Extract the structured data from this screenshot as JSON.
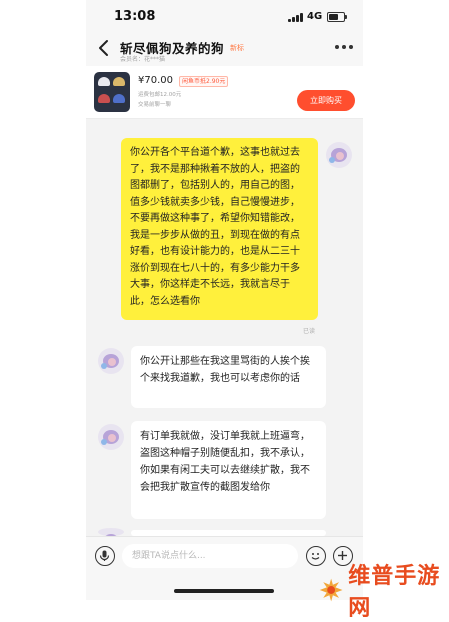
{
  "status_bar": {
    "time": "13:08",
    "network": "4G"
  },
  "header": {
    "title": "斩尽佩狗及养的狗",
    "tag": "新标",
    "subtitle": "会员名：花***猫"
  },
  "product": {
    "price": "¥70.00",
    "price_badge": "闲鱼币抵2.90元",
    "shipping": "运费包邮12.00元",
    "status": "交易前聊一聊",
    "buy_label": "立即购买"
  },
  "messages": [
    {
      "side": "mine",
      "text": "你公开各个平台道个歉，这事也就过去了，我不是那种揪着不放的人，把盗的图都删了，包括别人的，用自己的图，值多少钱就卖多少钱，自己慢慢进步，不要再做这种事了，希望你知错能改，我是一步步从做的丑，到现在做的有点好看，也有设计能力的，也是从二三十涨价到现在七八十的，有多少能力干多大事，你这样走不长远，我就言尽于此，怎么选看你",
      "read": "已读"
    },
    {
      "side": "theirs",
      "text": "你公开让那些在我这里骂街的人挨个挨个来找我道歉，我也可以考虑你的话"
    },
    {
      "side": "theirs",
      "text": "有订单我就做，没订单我就上班逼弯，盗图这种帽子别随便乱扣，我不承认，你如果有闲工夫可以去继续扩散，我不会把我扩散宣传的截图发给你"
    }
  ],
  "input": {
    "placeholder": "想跟TA说点什么..."
  },
  "watermark": {
    "text": "维普手游网"
  },
  "colors": {
    "accent": "#ff4e2e",
    "my_bubble": "#fff03c",
    "watermark": "#e84c1f"
  }
}
